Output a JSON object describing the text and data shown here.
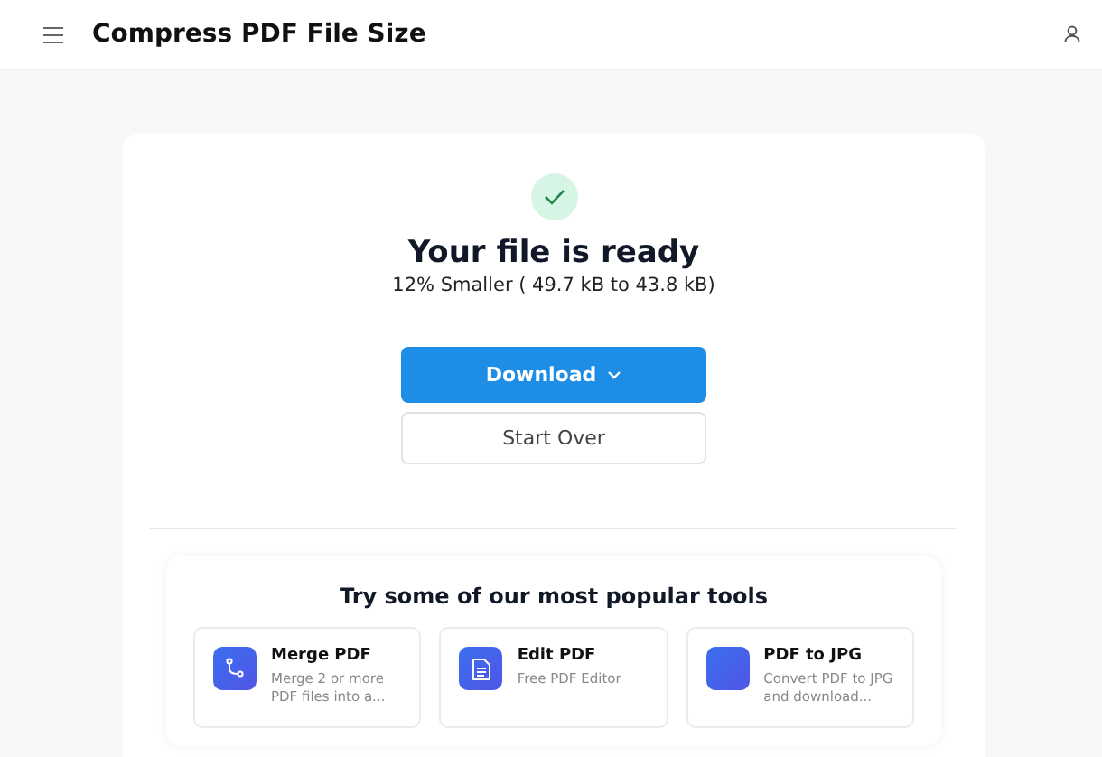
{
  "header": {
    "title": "Compress PDF File Size"
  },
  "result": {
    "title": "Your file is ready",
    "summary": "12% Smaller ( 49.7 kB to 43.8 kB)"
  },
  "buttons": {
    "download": "Download",
    "start_over": "Start Over"
  },
  "tools": {
    "heading": "Try some of our most popular tools",
    "items": [
      {
        "kind": "merge",
        "name": "Merge PDF",
        "description": "Merge 2 or more PDF files into a..."
      },
      {
        "kind": "edit",
        "name": "Edit PDF",
        "description": "Free PDF Editor"
      },
      {
        "kind": "convert",
        "name": "PDF to JPG",
        "description": "Convert PDF to JPG and download..."
      }
    ]
  }
}
